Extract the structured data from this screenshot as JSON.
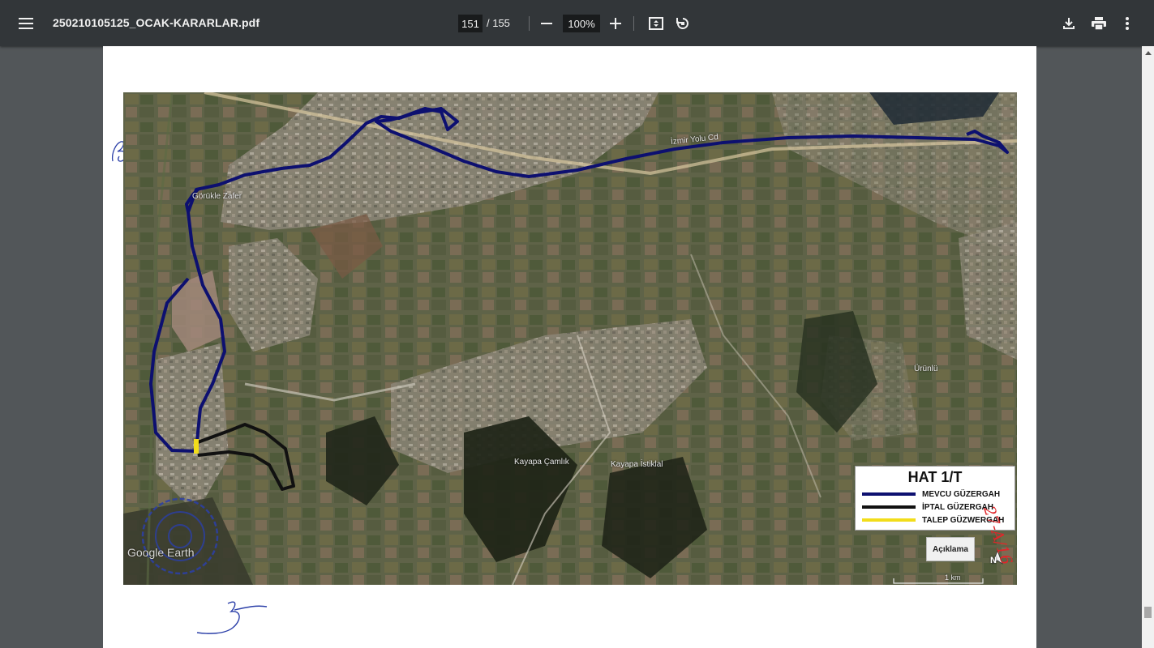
{
  "toolbar": {
    "menu_icon": "hamburger-menu-icon",
    "file_name": "250210105125_OCAK-KARARLAR.pdf",
    "current_page": "151",
    "page_separator": "/ 155",
    "zoom_value": "100%",
    "icons": [
      "minus-icon",
      "plus-icon",
      "fit-page-icon",
      "rotate-icon",
      "download-icon",
      "print-icon",
      "more-vert-icon"
    ]
  },
  "document": {
    "map": {
      "road_label": "İzmir Yolu Cd",
      "place_labels": {
        "gorukle": "Görükle Zafer",
        "kayapa_camlik": "Kayapa Çamlık",
        "kayapa_istiklal": "Kayapa İstiklal",
        "urunlu": "Ürünlü",
        "watermark": "Google Earth"
      },
      "scale_text": "1 km",
      "north_label": "N",
      "aciklama_button": "Açıklama",
      "legend": {
        "title": "HAT 1/T",
        "items": [
          {
            "label": "MEVCU GÜZERGAH",
            "color": "#0d1070"
          },
          {
            "label": "İPTAL GÜZERGAH",
            "color": "#111111"
          },
          {
            "label": "TALEP GÜZWERGAH",
            "color": "#f2dd1a"
          }
        ]
      }
    },
    "handwritten_note": "27-A/16"
  },
  "colors": {
    "toolbar_bg": "#323639",
    "viewer_bg": "#525659",
    "route_current": "#0d1070",
    "route_cancelled": "#111111",
    "route_requested": "#f2dd1a",
    "annotation_red": "#e0262a",
    "ink_blue": "#2b3fa8"
  }
}
